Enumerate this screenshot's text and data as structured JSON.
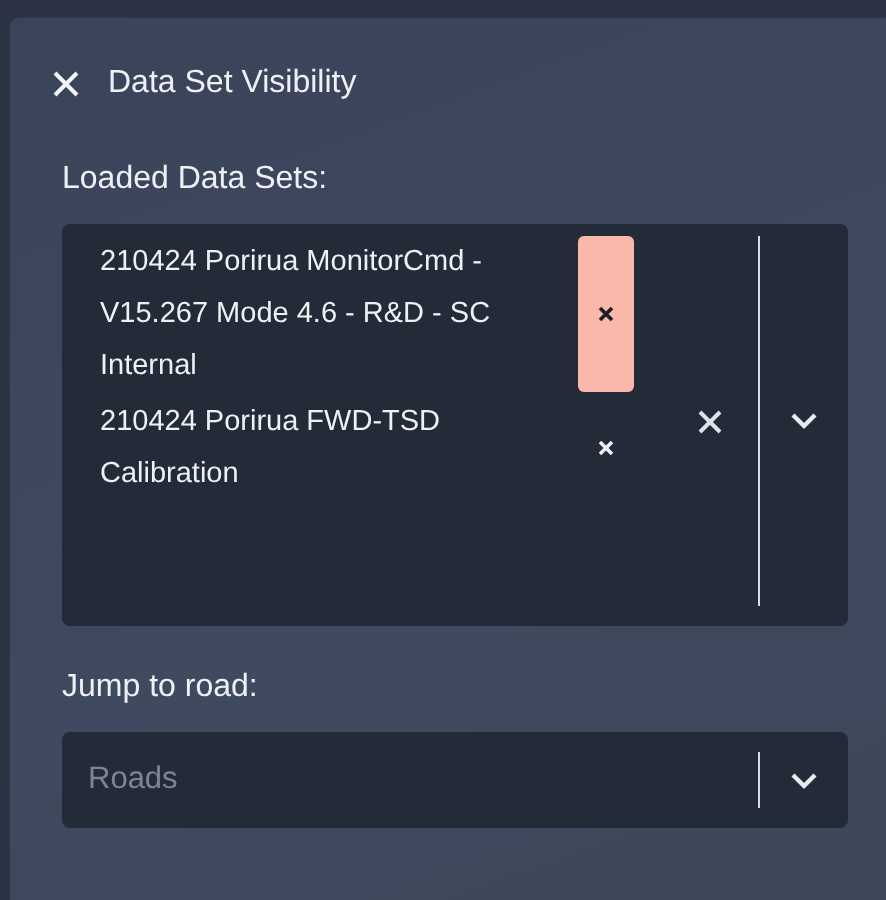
{
  "panel": {
    "title": "Data Set Visibility"
  },
  "loaded_data_sets": {
    "label": "Loaded Data Sets:",
    "items": [
      {
        "name": "210424 Porirua MonitorCmd - V15.267 Mode 4.6 - R&D - SC Internal",
        "remove_highlighted": true
      },
      {
        "name": "210424 Porirua FWD-TSD Calibration",
        "remove_highlighted": false
      }
    ]
  },
  "jump_to_road": {
    "label": "Jump to road:",
    "placeholder": "Roads"
  }
}
